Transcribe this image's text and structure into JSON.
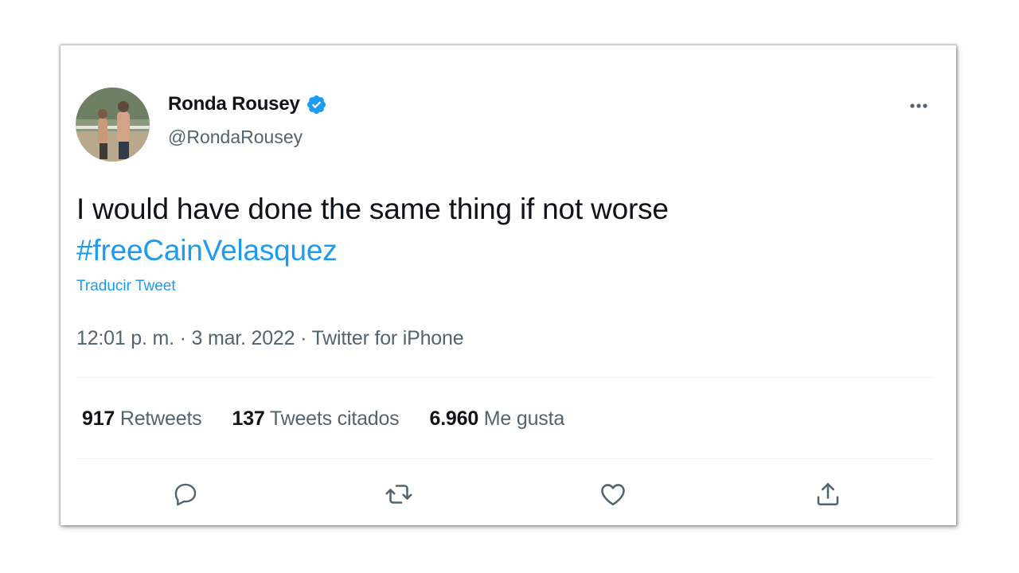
{
  "tweet": {
    "author_name": "Ronda Rousey",
    "author_handle": "@RondaRousey",
    "text": "I would have done the same thing if not worse",
    "hashtag": "#freeCainVelasquez",
    "translate_label": "Traducir Tweet",
    "meta": "12:01 p. m. · 3 mar. 2022 · Twitter for iPhone",
    "verified": true
  },
  "stats": [
    {
      "value": "917",
      "label": "Retweets"
    },
    {
      "value": "137",
      "label": "Tweets citados"
    },
    {
      "value": "6.960",
      "label": "Me gusta"
    }
  ],
  "icons": {
    "more": "more-horizontal-icon",
    "reply": "reply-icon",
    "retweet": "retweet-icon",
    "like": "heart-icon",
    "share": "share-icon",
    "verified": "verified-badge-icon"
  },
  "colors": {
    "accent": "#1d9bf0",
    "text": "#0f1419",
    "secondary": "#536471",
    "divider": "#eff3f4"
  }
}
